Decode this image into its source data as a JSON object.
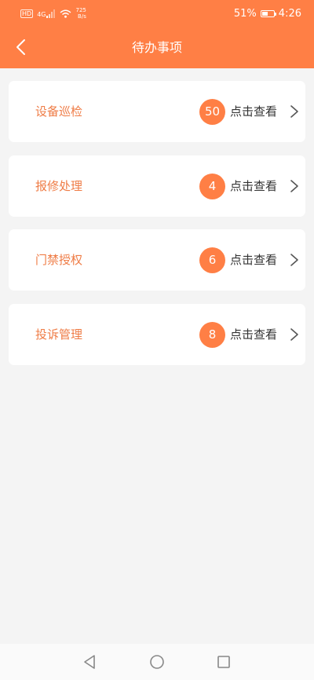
{
  "status_bar": {
    "hd_label": "HD",
    "network_label": "4G",
    "speed_value": "725",
    "speed_unit": "B/s",
    "battery_percent": "51%",
    "battery_level": 0.51,
    "time": "4:26"
  },
  "header": {
    "title": "待办事项"
  },
  "todos": [
    {
      "title": "设备巡检",
      "count": "50",
      "action": "点击查看"
    },
    {
      "title": "报修处理",
      "count": "4",
      "action": "点击查看"
    },
    {
      "title": "门禁授权",
      "count": "6",
      "action": "点击查看"
    },
    {
      "title": "投诉管理",
      "count": "8",
      "action": "点击查看"
    }
  ],
  "colors": {
    "brand": "#ff7f45",
    "title_text": "#ef7c46",
    "background": "#f4f4f4"
  },
  "icons": {
    "back": "chevron-left-icon",
    "row_arrow": "chevron-right-icon",
    "nav_back": "triangle-back-icon",
    "nav_home": "circle-home-icon",
    "nav_recent": "square-recent-icon"
  }
}
